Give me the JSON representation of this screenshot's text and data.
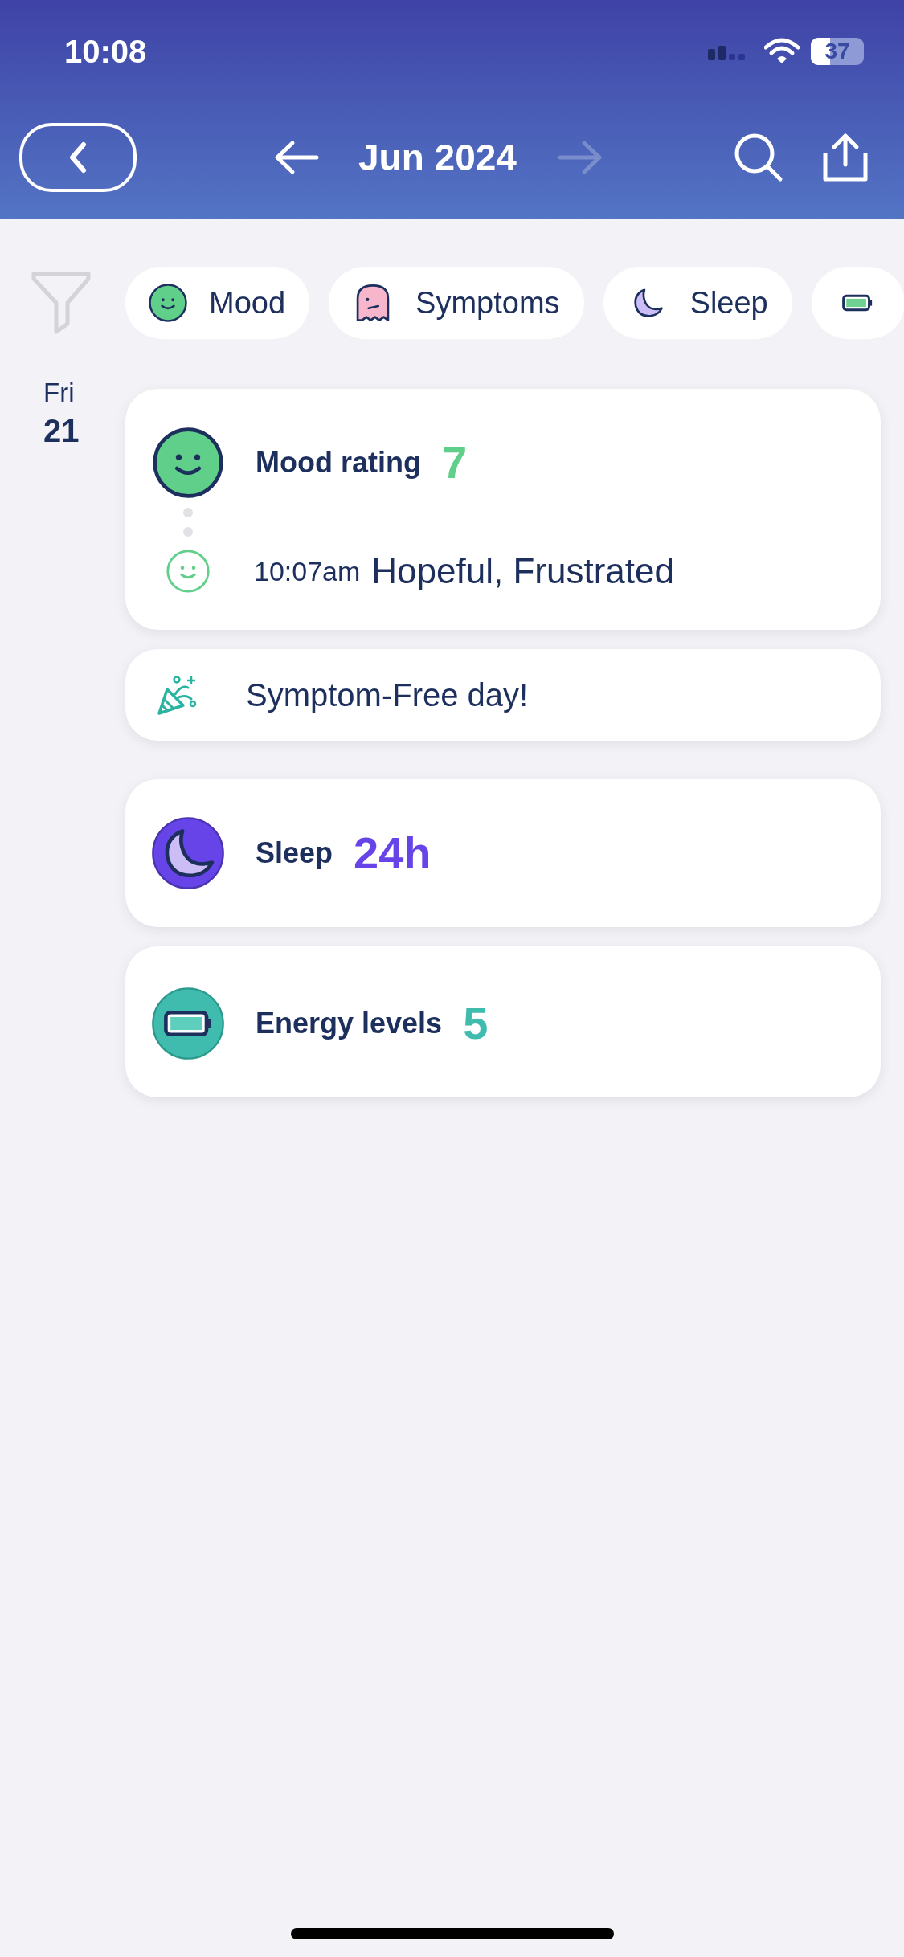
{
  "status_bar": {
    "time": "10:08",
    "battery": "37"
  },
  "header": {
    "title": "Jun 2024",
    "next_disabled": true
  },
  "filters": [
    {
      "kind": "mood",
      "label": "Mood"
    },
    {
      "kind": "symptoms",
      "label": "Symptoms"
    },
    {
      "kind": "sleep",
      "label": "Sleep"
    },
    {
      "kind": "energy"
    }
  ],
  "day": {
    "weekday": "Fri",
    "date": "21"
  },
  "entries": [
    {
      "kind": "mood",
      "title": "Mood rating",
      "value": "7",
      "color": "#5fcf8a",
      "notes": [
        {
          "time": "10:07am",
          "text": "Hopeful, Frustrated"
        }
      ]
    },
    {
      "kind": "message",
      "text": "Symptom-Free day!"
    },
    {
      "kind": "sleep",
      "title": "Sleep",
      "value": "24h",
      "color": "#6644e8"
    },
    {
      "kind": "energy",
      "title": "Energy levels",
      "value": "5",
      "color": "#3fbcae"
    }
  ]
}
